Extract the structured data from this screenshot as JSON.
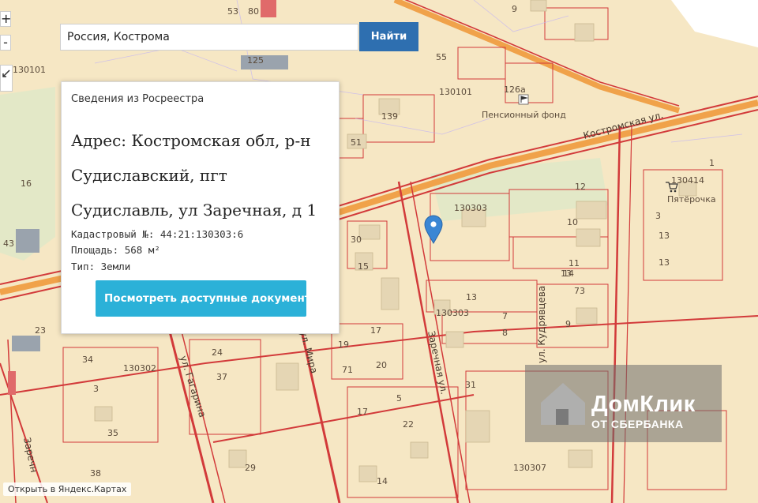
{
  "search": {
    "value": "Россия, Кострома",
    "button_label": "Найти"
  },
  "zoom": {
    "in_label": "+",
    "out_label": "-"
  },
  "popup": {
    "title": "Сведения из Росреестра",
    "address_line1": "Адрес: Костромская обл, р-н",
    "address_line2": "Судиславский, пгт",
    "address_line3": "Судиславль, ул Заречная, д 1",
    "cadastral": "Кадастровый №: 44:21:130303:6",
    "area": "Площадь: 568 м²",
    "type": "Тип: Земли",
    "button_label": "Посмотреть доступные документ"
  },
  "map": {
    "streets": {
      "kostromskaya": "Костромская ул.",
      "gagarina": "ул. Гагарина",
      "mira": "ул. Мира",
      "zarechnaya": "Заречная ул.",
      "kudryavtseva": "ул. Кудрявцева",
      "zarechnaya_left": "Заречн"
    },
    "blocks": [
      "130101",
      "130101",
      "130303",
      "130303",
      "130302",
      "130414",
      "130307"
    ],
    "places": {
      "pension_fund": "Пенсионный фонд",
      "pyaterochka": "Пятёрочка"
    },
    "house_numbers": [
      "53",
      "80",
      "125",
      "55",
      "126а",
      "139",
      "51",
      "43",
      "30",
      "15",
      "23",
      "34",
      "3",
      "35",
      "38",
      "24",
      "37",
      "29",
      "17",
      "19",
      "20",
      "71",
      "5",
      "22",
      "14",
      "31",
      "9",
      "12",
      "10",
      "11",
      "73",
      "13",
      "7",
      "8",
      "1",
      "3",
      "13",
      "13",
      "16",
      "17",
      "9",
      "14",
      "13"
    ],
    "marker_icon": "location-pin-icon",
    "pension_icon": "flag-icon",
    "shop_icon": "cart-icon"
  },
  "watermark": {
    "main": "ДомКлик",
    "sub": "ОТ СБЕРБАНКА",
    "logo_icon": "house-logo-icon"
  },
  "footer_link": "Открыть в Яндекс.Картах",
  "colors": {
    "map_bg": "#f6e7c4",
    "boundary": "#d23a3a",
    "main_road": "#f0a24a",
    "button": "#2e6fb0",
    "doc_button": "#2bb1d8"
  }
}
